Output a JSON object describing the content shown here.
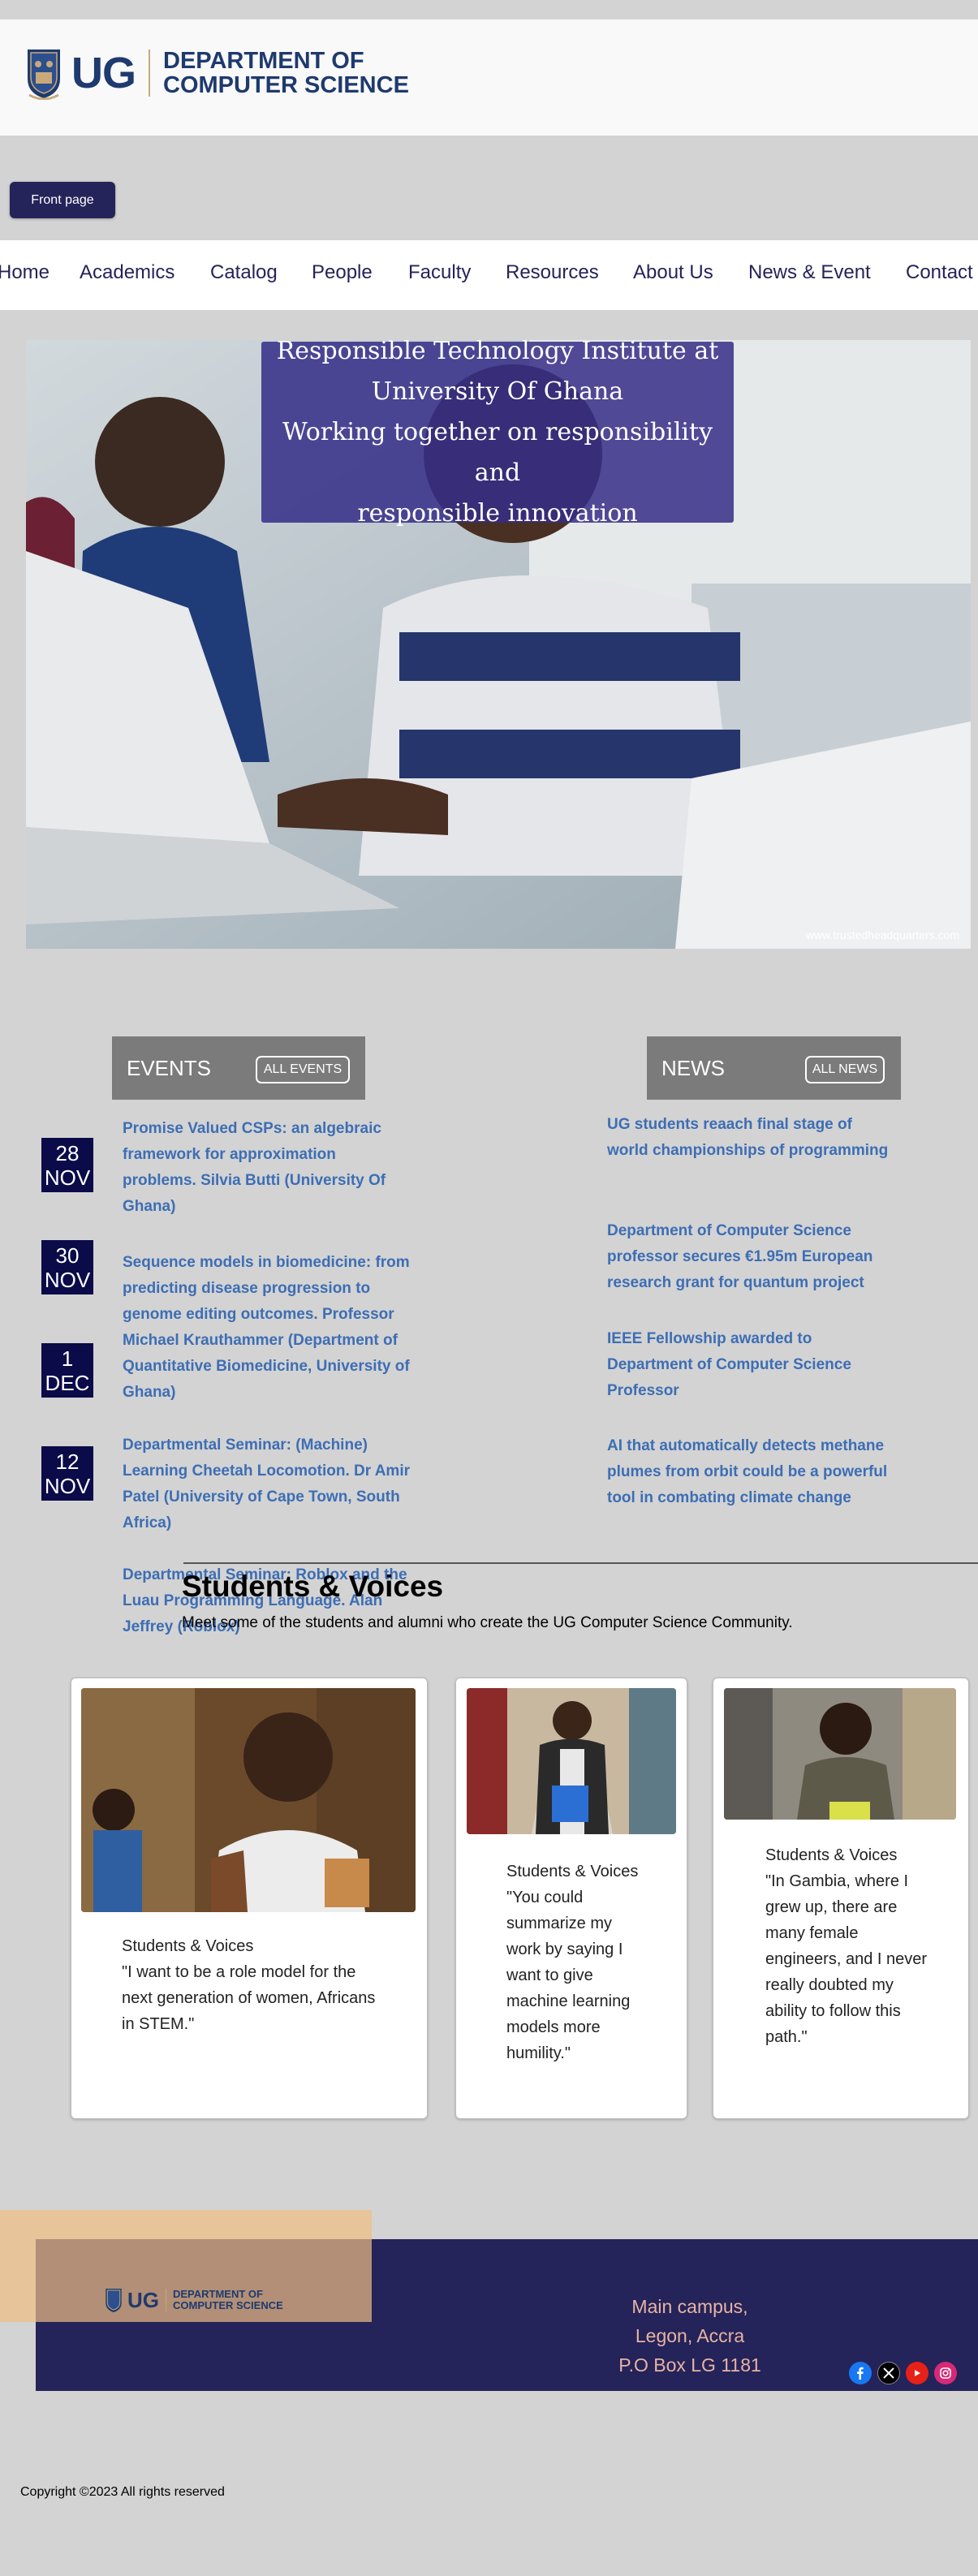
{
  "header": {
    "logo_text": "UG",
    "department_line1": "DEPARTMENT OF",
    "department_line2": "COMPUTER SCIENCE"
  },
  "front_page_button": "Front page",
  "nav": {
    "items": [
      "Home",
      "Academics",
      "Catalog",
      "People",
      "Faculty",
      "Resources",
      "About Us",
      "News & Event",
      "Contact"
    ]
  },
  "hero": {
    "line1": "Responsible Technology Institute at",
    "line2": "University Of Ghana",
    "line3": "Working together on responsibility and",
    "line4": "responsible innovation",
    "watermark": "www.trustedheadquarters.com"
  },
  "events": {
    "title": "EVENTS",
    "button": "ALL EVENTS",
    "dates": [
      {
        "day": "28",
        "month": "NOV"
      },
      {
        "day": "30",
        "month": "NOV"
      },
      {
        "day": "1",
        "month": "DEC"
      },
      {
        "day": "12",
        "month": "NOV"
      }
    ],
    "items": [
      "Promise Valued CSPs: an algebraic framework for approximation problems. Silvia Butti (University Of Ghana)",
      "Sequence models in biomedicine: from predicting disease progression to genome editing outcomes. Professor Michael Krauthammer (Department of Quantitative Biomedicine, University of Ghana)",
      "Departmental Seminar: (Machine) Learning Cheetah Locomotion. Dr Amir Patel (University of Cape Town, South Africa)",
      "Departmental Seminar: Roblox and the Luau Programming Language. Alan Jeffrey (Roblox)"
    ]
  },
  "news": {
    "title": "NEWS",
    "button": "ALL NEWS",
    "items": [
      "UG students reaach final stage of world championships of programming",
      "Department of Computer Science professor secures €1.95m European research grant for quantum project",
      "IEEE Fellowship awarded to Department of Computer Science Professor",
      "AI that automatically detects methane plumes from orbit could be a powerful tool in combating climate change"
    ]
  },
  "students_voices": {
    "title": "Students & Voices",
    "subtitle": "Meet some of the students and alumni who create the UG Computer Science Community.",
    "cards": [
      {
        "label": "Students & Voices",
        "quote": "\"I want to be a role model for the next generation of women, Africans in STEM.\""
      },
      {
        "label": "Students & Voices",
        "quote": "\"You could summarize my work by saying I want to give machine learning models more humility.\""
      },
      {
        "label": "Students & Voices",
        "quote": "\"In Gambia, where I grew up, there are many female engineers, and I never really doubted my ability to follow this path.\""
      }
    ]
  },
  "footer": {
    "logo_text": "UG",
    "department_line1": "DEPARTMENT OF",
    "department_line2": "COMPUTER SCIENCE",
    "address_line1": "Main campus,",
    "address_line2": "Legon, Accra",
    "address_line3": "P.O Box LG 1181",
    "social_icons": [
      "facebook-icon",
      "x-icon",
      "youtube-icon",
      "instagram-icon"
    ]
  },
  "copyright": "Copyright ©2023 All rights reserved"
}
